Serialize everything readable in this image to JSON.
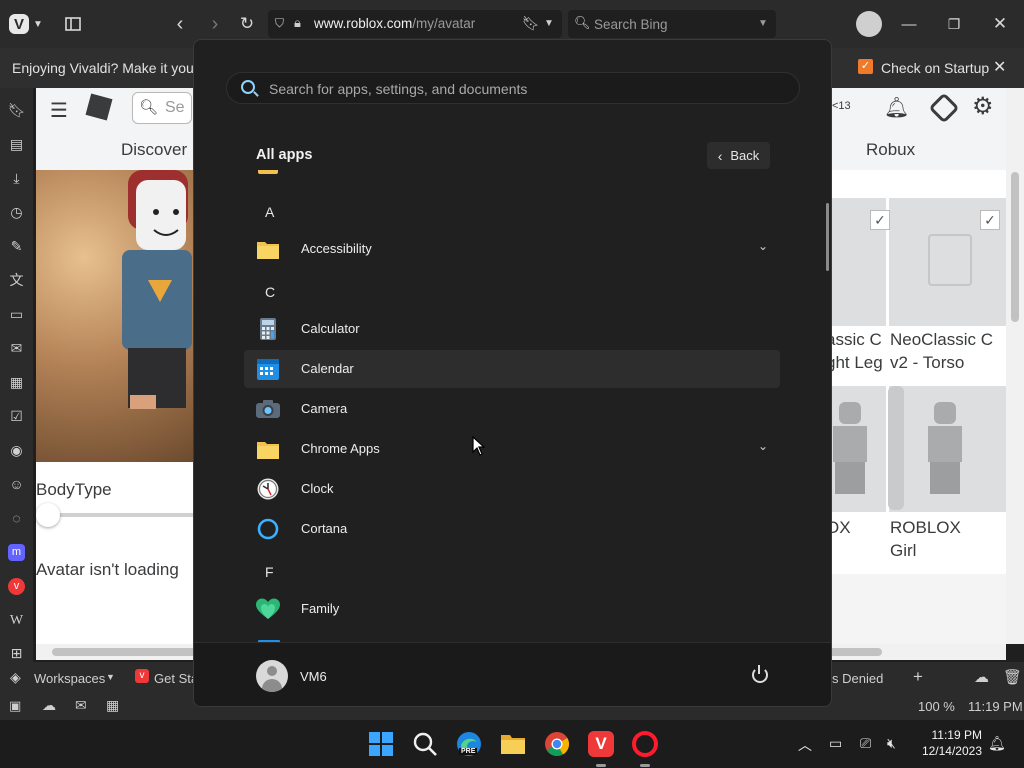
{
  "browser": {
    "url_domain": "www.roblox.com",
    "url_path": "/my/avatar",
    "search_placeholder": "Search Bing",
    "notification": "Enjoying Vivaldi? Make it your d",
    "check_startup_label": "Check on Startup",
    "status_workspaces": "Workspaces",
    "status_tab_get_started": "Get Sta",
    "status_tab_denied": "s Denied",
    "zoom": "100 %",
    "status_time": "11:19 PM"
  },
  "webpage": {
    "search_placeholder": "Se",
    "robux_count": "<13",
    "discover": "Discover",
    "robux": "Robux",
    "body_type_label": "BodyType",
    "body_type_value": 0,
    "avatar_message": "Avatar isn't loading",
    "items": [
      {
        "name_line1": "assic C",
        "name_line2": "ght Leg"
      },
      {
        "name_line1": "NeoClassic C",
        "name_line2": "v2 - Torso"
      },
      {
        "name_line1": "OX",
        "name_line2": ""
      },
      {
        "name_line1": "ROBLOX",
        "name_line2": "Girl"
      }
    ]
  },
  "start_menu": {
    "search_placeholder": "Search for apps, settings, and documents",
    "section_title": "All apps",
    "back_label": "Back",
    "letters": [
      "A",
      "C",
      "F"
    ],
    "apps": [
      {
        "name": "Accessibility",
        "icon": "folder-icon",
        "expandable": true
      },
      {
        "name": "Calculator",
        "icon": "calculator-icon",
        "expandable": false
      },
      {
        "name": "Calendar",
        "icon": "calendar-icon",
        "expandable": false
      },
      {
        "name": "Camera",
        "icon": "camera-icon",
        "expandable": false
      },
      {
        "name": "Chrome Apps",
        "icon": "folder-icon",
        "expandable": true
      },
      {
        "name": "Clock",
        "icon": "clock-icon",
        "expandable": false
      },
      {
        "name": "Cortana",
        "icon": "cortana-icon",
        "expandable": false
      },
      {
        "name": "Family",
        "icon": "family-icon",
        "expandable": false
      }
    ],
    "user_name": "VM6"
  },
  "taskbar": {
    "time": "11:19 PM",
    "date": "12/14/2023",
    "edge_badge": "PRE"
  },
  "colors": {
    "accent_orange": "#ef7a2a",
    "start_bg": "#202020",
    "windows_blue": "#1fa3ff",
    "vivaldi_red": "#ef3939",
    "opera_red": "#ff1b2d"
  }
}
